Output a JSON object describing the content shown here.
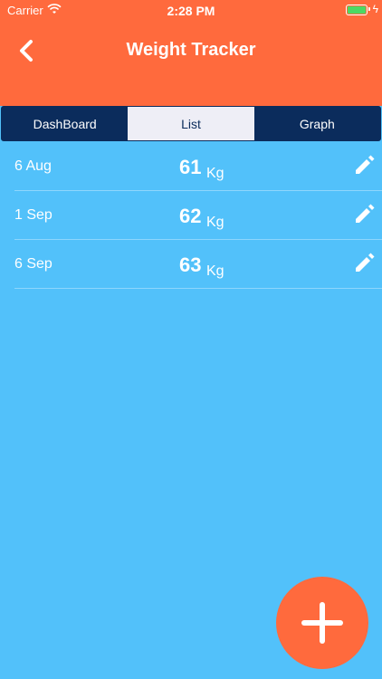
{
  "status": {
    "carrier": "Carrier",
    "time": "2:28 PM"
  },
  "header": {
    "title": "Weight Tracker"
  },
  "tabs": [
    {
      "label": "DashBoard",
      "active": false
    },
    {
      "label": "List",
      "active": true
    },
    {
      "label": "Graph",
      "active": false
    }
  ],
  "entries": [
    {
      "date": "6 Aug",
      "weight": "61",
      "unit": "Kg"
    },
    {
      "date": "1 Sep",
      "weight": "62",
      "unit": "Kg"
    },
    {
      "date": "6 Sep",
      "weight": "63",
      "unit": "Kg"
    }
  ],
  "colors": {
    "accent": "#ff6a3d",
    "background": "#52c1fa",
    "navy": "#0b2c5c"
  },
  "icons": {
    "back": "chevron-left-icon",
    "edit": "pencil-icon",
    "add": "plus-icon"
  }
}
